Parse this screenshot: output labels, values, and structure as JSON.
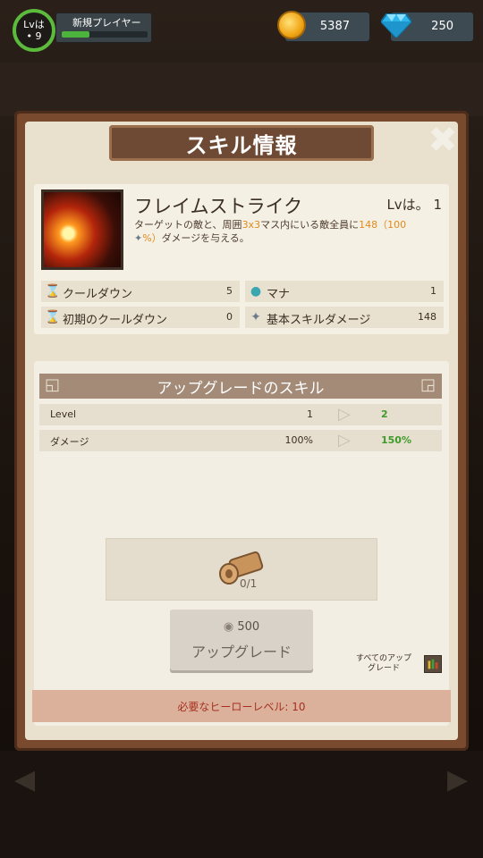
{
  "hud": {
    "level_label": "Lvは",
    "level_value": "• 9",
    "player_name": "新規プレイヤー",
    "xp_progress": 0.32,
    "gold": "5387",
    "gems": "250"
  },
  "dialog": {
    "title": "スキル情報",
    "close_icon": "close-icon"
  },
  "skill": {
    "name": "フレイムストライク",
    "level": "Lvは。 1",
    "desc_part1": "ターゲットの敵と、周囲",
    "desc_area": "3x3",
    "desc_part2": "マス内にいる敵全員に",
    "desc_pct": "148（100",
    "desc_pct_end": "%）",
    "desc_part3": "ダメージを与える。",
    "stats": {
      "cooldown_label": "クールダウン",
      "cooldown_value": "5",
      "mana_label": "マナ",
      "mana_value": "1",
      "initial_cooldown_label": "初期のクールダウン",
      "initial_cooldown_value": "0",
      "base_damage_label": "基本スキルダメージ",
      "base_damage_value": "148"
    }
  },
  "upgrade": {
    "header": "アップグレードのスキル",
    "rows": [
      {
        "label": "Level",
        "current": "1",
        "next": "2"
      },
      {
        "label": "ダメージ",
        "current": "100%",
        "next": "150%"
      }
    ],
    "material_count": "0/1",
    "button_cost": "500",
    "button_label": "アップグレード",
    "all_upgrades_label_1": "すべてのアップ",
    "all_upgrades_label_2": "グレード",
    "requirement": "必要なヒーローレベル: 10"
  },
  "colors": {
    "accent_green": "#3f9a2a",
    "highlight_orange": "#e08a1e",
    "requirement_red": "#a6301f",
    "panel_brown": "#7a4a2e"
  }
}
